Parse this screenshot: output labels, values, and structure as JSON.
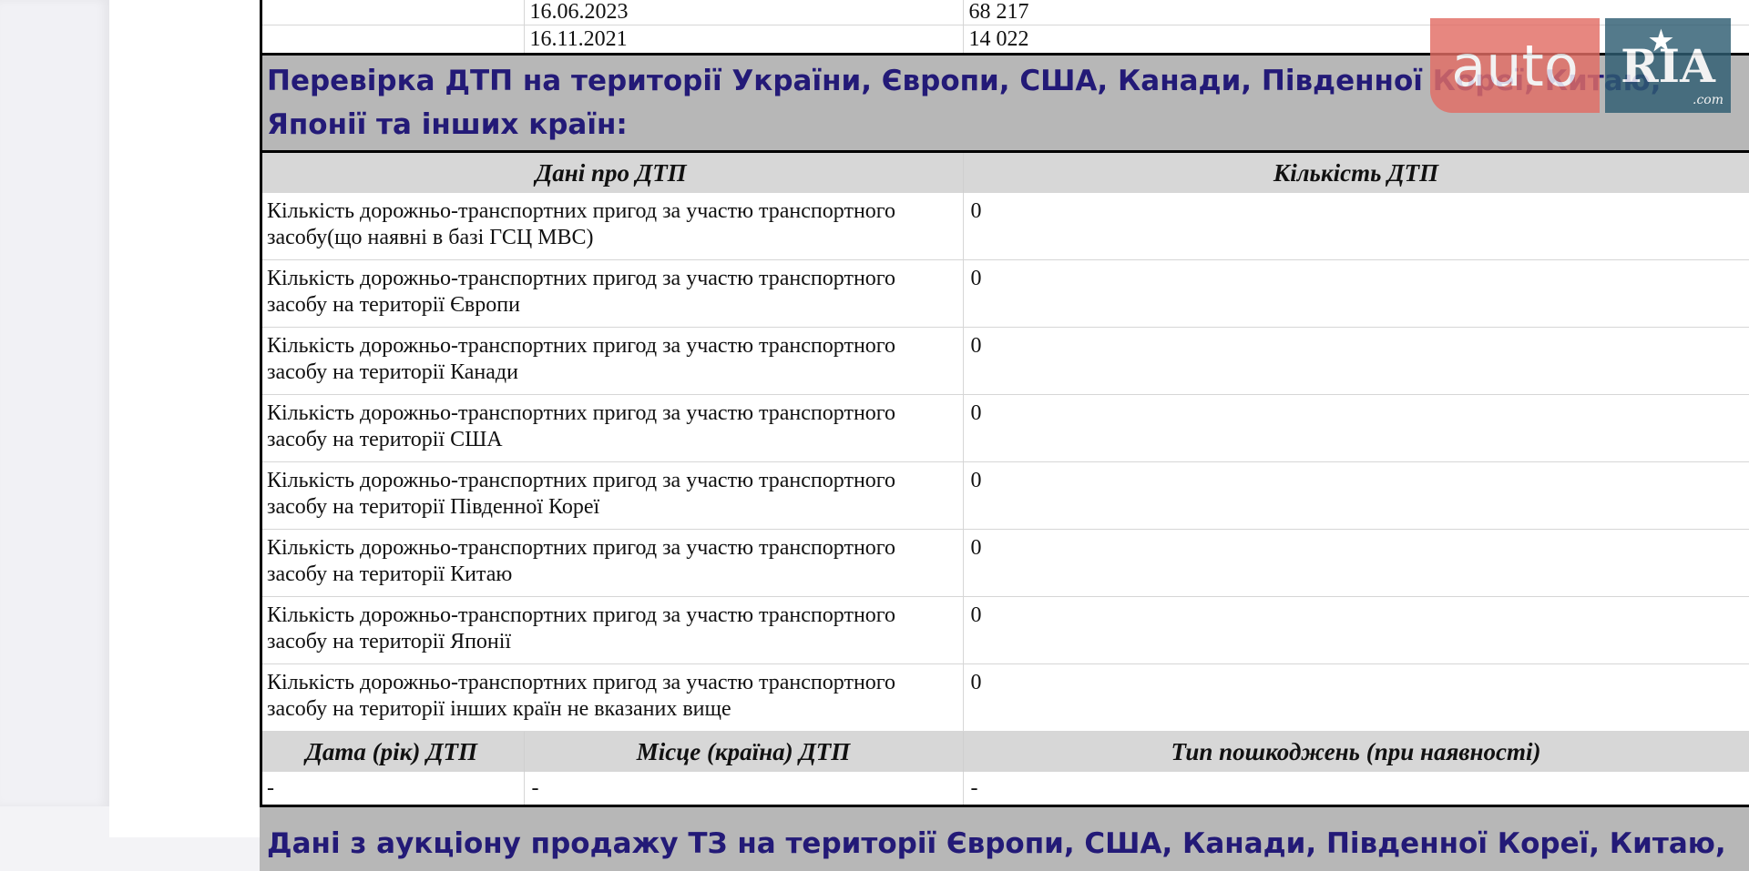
{
  "top_rows": [
    {
      "date": "16.06.2023",
      "mileage": "68 217"
    },
    {
      "date": "16.11.2021",
      "mileage": "14 022"
    }
  ],
  "accident_section": {
    "title": "Перевірка ДТП на території України, Європи, США, Канади, Південної Кореї, Китаю, Японії та інших країн:",
    "col_data": "Дані про ДТП",
    "col_count": "Кількість ДТП",
    "rows": [
      {
        "label": "Кількість дорожньо-транспортних пригод за участю транспортного засобу(що наявні в базі ГСЦ МВС)",
        "count": "0"
      },
      {
        "label": "Кількість дорожньо-транспортних пригод за участю транспортного засобу на території Європи",
        "count": "0"
      },
      {
        "label": "Кількість дорожньо-транспортних пригод за участю транспортного засобу на території Канади",
        "count": "0"
      },
      {
        "label": "Кількість дорожньо-транспортних пригод за участю транспортного засобу на території США",
        "count": "0"
      },
      {
        "label": "Кількість дорожньо-транспортних пригод за участю транспортного засобу на території Південної Кореї",
        "count": "0"
      },
      {
        "label": "Кількість дорожньо-транспортних пригод за участю транспортного засобу на території Китаю",
        "count": "0"
      },
      {
        "label": "Кількість дорожньо-транспортних пригод за участю транспортного засобу на території Японії",
        "count": "0"
      },
      {
        "label": "Кількість дорожньо-транспортних пригод за участю транспортного засобу на території інших країн не вказаних вище",
        "count": "0"
      }
    ],
    "detail_headers": {
      "date": "Дата (рік) ДТП",
      "place": "Місце (країна) ДТП",
      "damage": "Тип пошкоджень (при наявності)"
    },
    "detail_row": {
      "date": "-",
      "place": "-",
      "damage": "-"
    }
  },
  "auction_section": {
    "title": "Дані з аукціону продажу ТЗ на території Європи, США, Канади, Південної Кореї, Китаю,"
  },
  "watermark": {
    "auto_text": "auto",
    "ria_text": "RIA",
    "com_text": ".com"
  }
}
